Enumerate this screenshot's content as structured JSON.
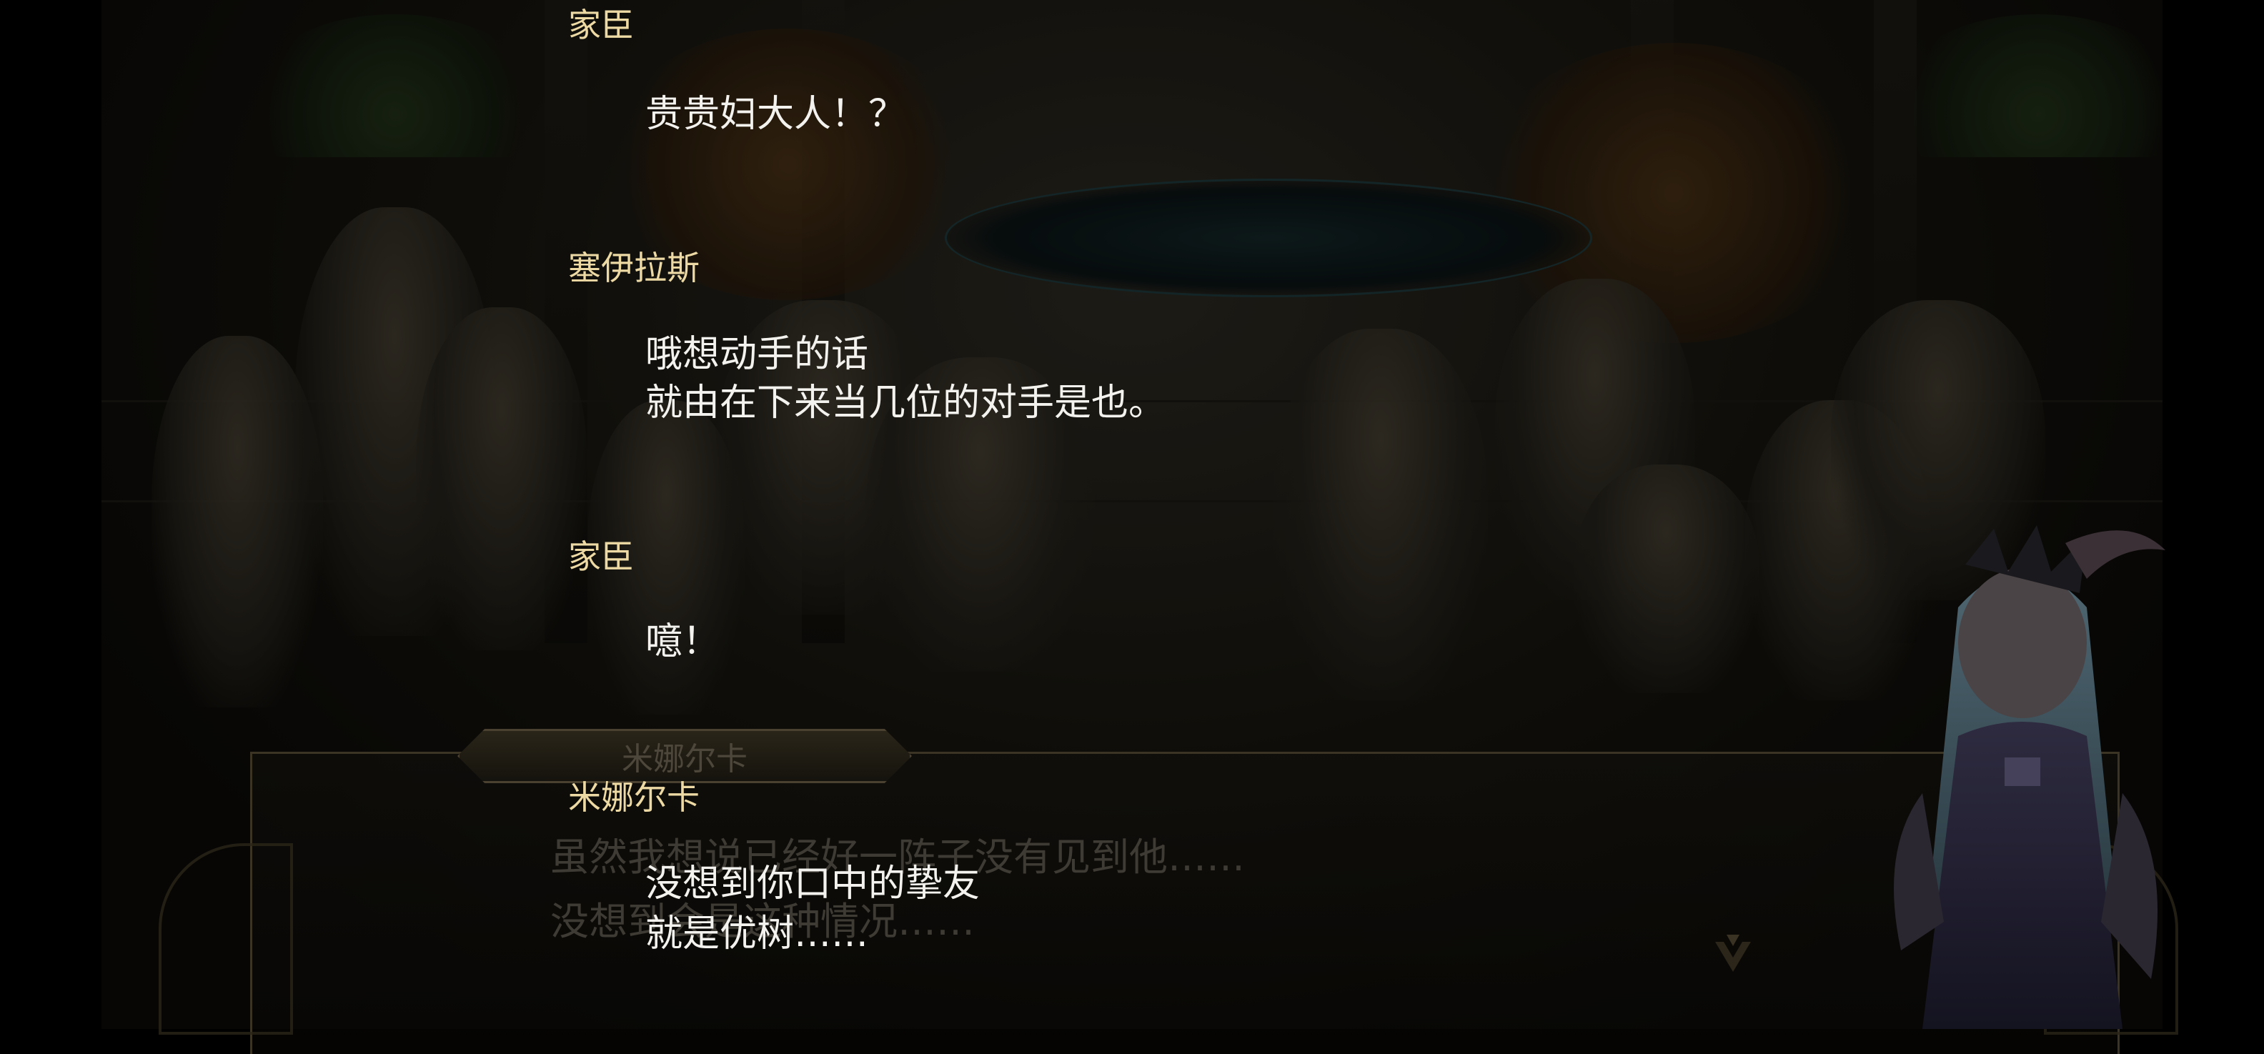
{
  "background_scene": {
    "old_dialogue": {
      "speaker": "米娜尔卡",
      "lines": [
        "虽然我想说已经好一阵子没有见到他……",
        "没想到会是这种情况……"
      ]
    },
    "next_icon": "chevron-down-ornament-icon"
  },
  "backlog": [
    {
      "speaker": "家臣",
      "lines": [
        "贵贵妇大人！？"
      ]
    },
    {
      "speaker": "塞伊拉斯",
      "lines": [
        "哦想动手的话",
        "就由在下来当几位的对手是也。"
      ]
    },
    {
      "speaker": "家臣",
      "lines": [
        "噫！"
      ]
    },
    {
      "speaker": "米娜尔卡",
      "lines": [
        "没想到你口中的挚友",
        "就是优树……"
      ]
    }
  ],
  "colors": {
    "speaker_name": "#ecd9a4",
    "dialogue_text": "#f4f2ee",
    "backdrop": "#000000"
  }
}
